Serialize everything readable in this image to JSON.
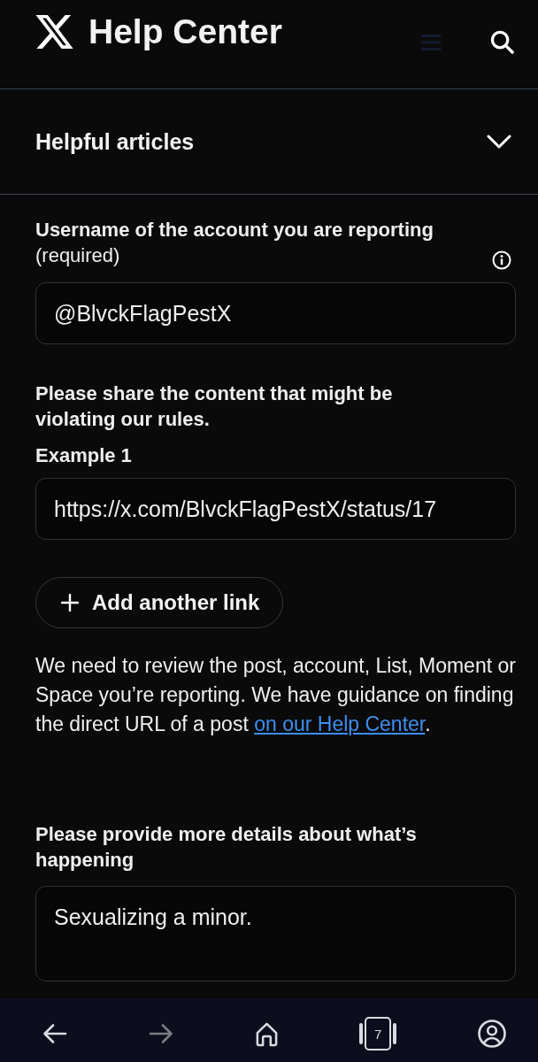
{
  "header": {
    "title": "Help Center"
  },
  "accordion": {
    "label": "Helpful articles",
    "expanded": false
  },
  "form": {
    "username": {
      "label": "**Username of the account you are reporting** (required)",
      "value": "@BlvckFlagPestX"
    },
    "content": {
      "prompt": "Please share the content that might be violating our rules.",
      "examples": [
        {
          "label": "Example 1",
          "value": "https://x.com/BlvckFlagPestX/status/17"
        }
      ],
      "add_button": "Add another link"
    },
    "guidance": {
      "text": "We need to review the post, account, List, Moment or Space you’re reporting. We have guidance on finding the direct URL of a post ",
      "link": "on our Help Center",
      "end": "."
    },
    "details": {
      "label": "Please provide more details about what’s happening",
      "value": "Sexualizing a minor."
    }
  },
  "browser_bar": {
    "buttons": [
      {
        "kind": "back",
        "disabled": false
      },
      {
        "kind": "forward",
        "disabled": true
      },
      {
        "kind": "home"
      },
      {
        "kind": "tabs",
        "count": "7"
      },
      {
        "kind": "profile"
      }
    ]
  }
}
